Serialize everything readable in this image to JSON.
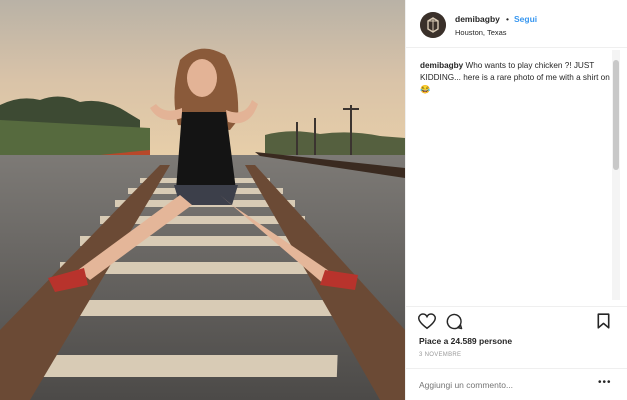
{
  "post": {
    "username": "demibagby",
    "separator": "•",
    "follow_label": "Segui",
    "location": "Houston, Texas",
    "caption_user": "demibagby",
    "caption_text": "Who wants to play chicken ?! JUST KIDDING... here is a rare photo of me with a shirt on😂",
    "likes": "Piace a 24.589 persone",
    "date": "3 NOVEMBRE",
    "comment_placeholder": "Aggiungi un commento...",
    "more_label": "•••"
  },
  "icons": [
    "heart-icon",
    "comment-icon",
    "bookmark-icon",
    "avatar-logo"
  ],
  "colors": {
    "link": "#3897f0",
    "text": "#262626",
    "muted": "#999999",
    "border": "#efefef"
  }
}
